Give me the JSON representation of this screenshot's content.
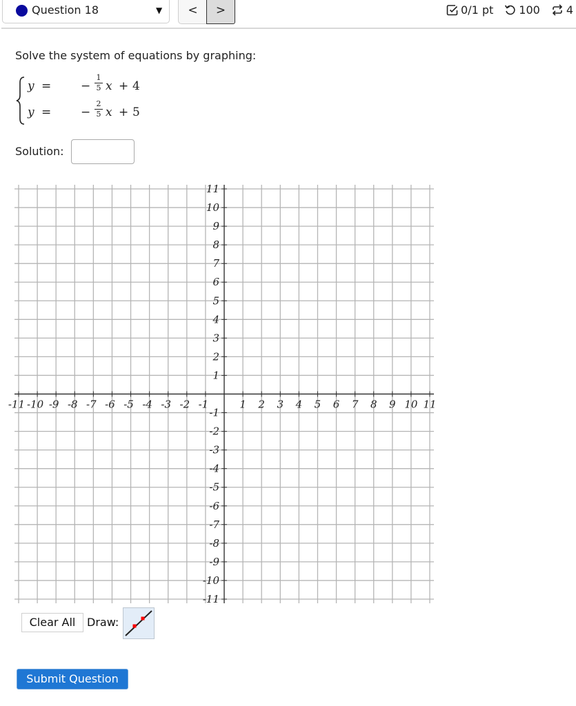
{
  "header": {
    "question_selector": {
      "label": "Question 18",
      "status_color": "#0a0a9e"
    },
    "nav": {
      "prev_label": "<",
      "next_label": ">"
    },
    "score": {
      "points": "0/1 pt",
      "retries": "100",
      "attempts": "4"
    }
  },
  "question": {
    "prompt": "Solve the system of equations by graphing:",
    "equations": [
      {
        "lhs": "y",
        "eq": "=",
        "sign": "−",
        "num": "1",
        "den": "5",
        "var": "x",
        "op": "+",
        "const": "4"
      },
      {
        "lhs": "y",
        "eq": "=",
        "sign": "−",
        "num": "2",
        "den": "5",
        "var": "x",
        "op": "+",
        "const": "5"
      }
    ],
    "solution_label": "Solution:",
    "solution_value": "",
    "solution_placeholder": ""
  },
  "graph": {
    "x_min": -11,
    "x_max": 11,
    "y_min": -11,
    "y_max": 11,
    "x_ticks": [
      "-11",
      "-10",
      "-9",
      "-8",
      "-7",
      "-6",
      "-5",
      "-4",
      "-3",
      "-2",
      "-1",
      "1",
      "2",
      "3",
      "4",
      "5",
      "6",
      "7",
      "8",
      "9",
      "10",
      "11"
    ],
    "y_ticks": [
      "11",
      "10",
      "9",
      "8",
      "7",
      "6",
      "5",
      "4",
      "3",
      "2",
      "1",
      "-1",
      "-2",
      "-3",
      "-4",
      "-5",
      "-6",
      "-7",
      "-8",
      "-9",
      "-10",
      "-11"
    ],
    "grid_color": "#b5b5b5",
    "axis_color": "#333333"
  },
  "tools": {
    "clear_label": "Clear All",
    "draw_label": "Draw:",
    "draw_tool_icon": "line-segment-icon",
    "point_color": "#ff0000"
  },
  "submit_label": "Submit Question",
  "colors": {
    "submit_bg": "#1f77d4"
  }
}
